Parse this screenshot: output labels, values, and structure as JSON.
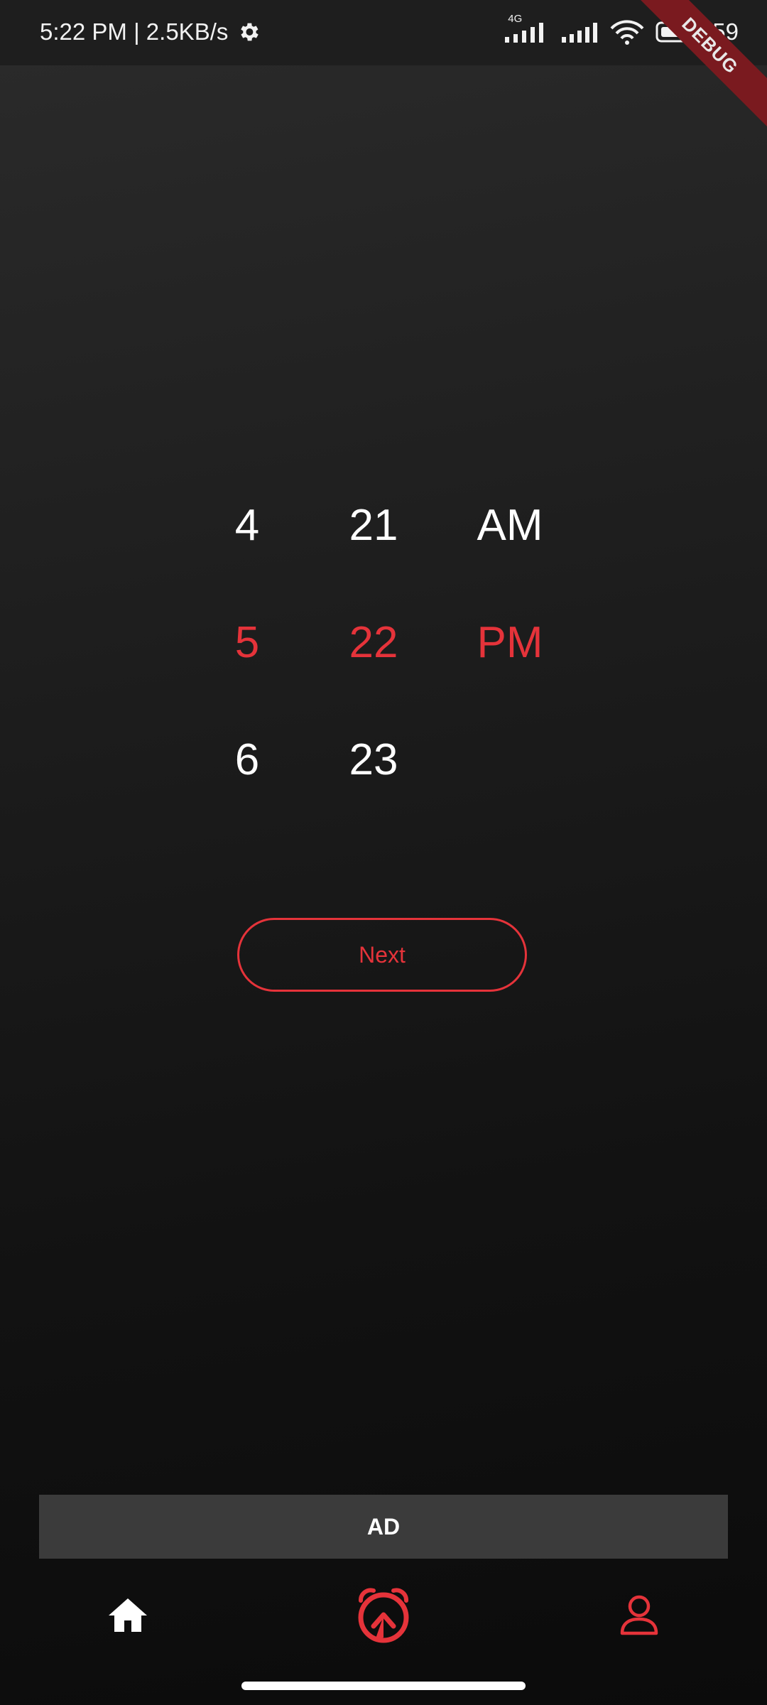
{
  "status_bar": {
    "time_speed": "5:22 PM | 2.5KB/s",
    "network_type": "4G",
    "battery_level": "59",
    "icons": [
      "gear-icon",
      "signal-icon",
      "signal-icon",
      "wifi-icon",
      "battery-icon"
    ]
  },
  "debug_banner": {
    "label": "DEBUG"
  },
  "time_picker": {
    "hours": [
      "4",
      "5",
      "6"
    ],
    "minutes": [
      "21",
      "22",
      "23"
    ],
    "periods": [
      "AM",
      "PM"
    ],
    "selected": {
      "hour": "5",
      "minute": "22",
      "period": "PM"
    }
  },
  "actions": {
    "next_label": "Next"
  },
  "ad": {
    "label": "AD"
  },
  "bottom_nav": {
    "items": [
      {
        "icon": "home-icon",
        "active": false
      },
      {
        "icon": "alarm-icon",
        "active": true
      },
      {
        "icon": "profile-icon",
        "active": false
      }
    ]
  },
  "colors": {
    "accent": "#e5333a",
    "text": "#ffffff",
    "ad_background": "#3b3b3b"
  }
}
